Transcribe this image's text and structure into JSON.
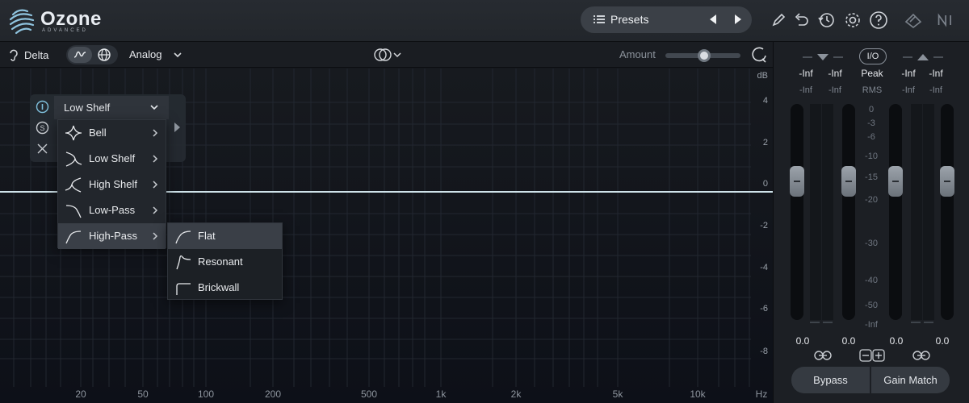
{
  "app": {
    "name": "Ozone",
    "edition": "ADVANCED"
  },
  "presets": {
    "label": "Presets"
  },
  "toolbar": {
    "delta_label": "Delta",
    "analog_label": "Analog",
    "amount_label": "Amount",
    "amount_level": 0.52
  },
  "eq": {
    "db_unit": "dB",
    "db_ticks": [
      "4",
      "2",
      "0",
      "-2",
      "-4",
      "-6",
      "-8"
    ],
    "hz_unit": "Hz",
    "hz_ticks": [
      "20",
      "50",
      "100",
      "200",
      "500",
      "1k",
      "2k",
      "5k",
      "10k"
    ]
  },
  "band": {
    "type_label": "Low Shelf"
  },
  "filter_menu": {
    "items": [
      {
        "label": "Bell"
      },
      {
        "label": "Low Shelf"
      },
      {
        "label": "High Shelf"
      },
      {
        "label": "Low-Pass"
      },
      {
        "label": "High-Pass"
      }
    ],
    "active_index": 4,
    "submenu": {
      "items": [
        {
          "label": "Flat"
        },
        {
          "label": "Resonant"
        },
        {
          "label": "Brickwall"
        }
      ],
      "active_index": 0
    }
  },
  "meters": {
    "io_label": "I/O",
    "peak_label": "Peak",
    "rms_label": "RMS",
    "input_peak": [
      "-Inf",
      "-Inf"
    ],
    "input_rms": [
      "-Inf",
      "-Inf"
    ],
    "output_peak": [
      "-Inf",
      "-Inf"
    ],
    "output_rms": [
      "-Inf",
      "-Inf"
    ],
    "scale": [
      "0",
      "-3",
      "-6",
      "-10",
      "-15",
      "-20",
      "-30",
      "-40",
      "-50",
      "-Inf"
    ],
    "fader_values": [
      "0.0",
      "0.0",
      "0.0",
      "0.0"
    ],
    "bypass_label": "Bypass",
    "gain_match_label": "Gain Match"
  }
}
